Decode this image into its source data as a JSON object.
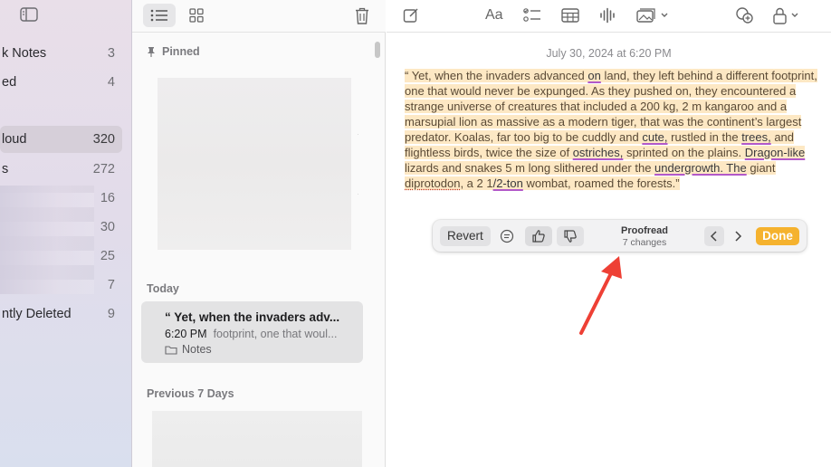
{
  "sidebar": {
    "items": [
      {
        "label": "k Notes",
        "count": "3"
      },
      {
        "label": "ed",
        "count": "4"
      },
      {
        "label": "loud",
        "count": "320"
      },
      {
        "label": "s",
        "count": "272"
      },
      {
        "label": "",
        "count": "16"
      },
      {
        "label": "",
        "count": "30"
      },
      {
        "label": "",
        "count": "25"
      },
      {
        "label": "",
        "count": "7"
      },
      {
        "label": "ntly Deleted",
        "count": "9"
      }
    ]
  },
  "list": {
    "pinned_header": "Pinned",
    "today_header": "Today",
    "previous_header": "Previous 7 Days",
    "note": {
      "title": "“ Yet, when the invaders adv...",
      "time": "6:20 PM",
      "preview": "footprint, one that woul...",
      "folder": "Notes"
    }
  },
  "editor": {
    "date": "July 30, 2024 at 6:20 PM",
    "toolbar": {
      "format_label": "Aa"
    },
    "body": {
      "s1": "“ Yet, when the invaders advanced ",
      "c1": "on",
      "s2": " land, they left behind a different footprint, one that would never be expunged. As they pushed on, they encountered a strange universe of creatures that included a 200 kg, 2 m kangaroo and a marsupial lion as massive as a modern tiger, that was the continent’s largest predator. Koalas, far too big to be cuddly and ",
      "c2": "cute,",
      "s3": " rustled in the ",
      "c3": "trees,",
      "s4": " and flightless birds, twice the size of ",
      "c4": "ostriches,",
      "s5": " sprinted on the plains. ",
      "c5": "Dragon-like",
      "s6": " lizards and snakes 5 m long slithered under the ",
      "c6": "undergrowth. The",
      "s7": " giant ",
      "c7": "diprotodon",
      "s8": ", a 2 1",
      "c8": "/2-ton",
      "s9": " wombat, roamed the forests.”"
    }
  },
  "proofread": {
    "revert_label": "Revert",
    "title": "Proofread",
    "subtitle": "7 changes",
    "done_label": "Done"
  },
  "colors": {
    "accent": "#f5b22e",
    "highlight": "#fde8c4",
    "annotation_arrow": "#ee4035"
  }
}
